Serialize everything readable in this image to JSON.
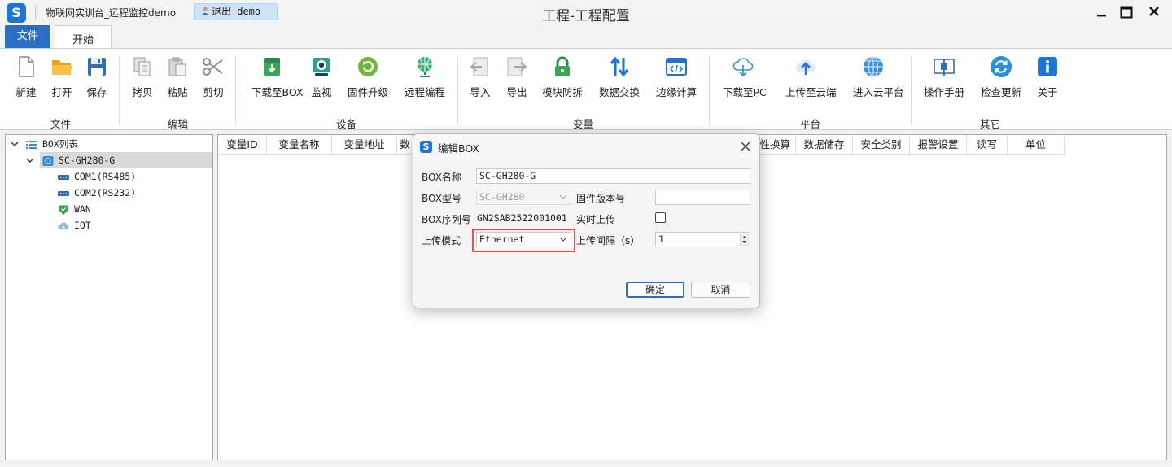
{
  "titlebar": {
    "project_name": "物联网实训台_远程监控demo",
    "logout_label": "退出 demo",
    "window_title": "工程-工程配置"
  },
  "tabs": {
    "file": "文件",
    "start": "开始"
  },
  "ribbon": {
    "groups": {
      "file": "文件",
      "edit": "编辑",
      "device": "设备",
      "variable": "变量",
      "platform": "平台",
      "other": "其它"
    },
    "buttons": {
      "new": "新建",
      "open": "打开",
      "save": "保存",
      "copy": "拷贝",
      "paste": "粘贴",
      "cut": "剪切",
      "download_box": "下载至BOX",
      "monitor": "监视",
      "firmware": "固件升级",
      "remote_prog": "远程编程",
      "import": "导入",
      "export": "导出",
      "module_protect": "模块防拆",
      "data_exchange": "数据交换",
      "edge_compute": "边缘计算",
      "download_pc": "下载至PC",
      "upload_cloud": "上传至云端",
      "enter_cloud": "进入云平台",
      "manual": "操作手册",
      "check_update": "检查更新",
      "about": "关于"
    }
  },
  "tree": {
    "root": "BOX列表",
    "box": "SC-GH280-G",
    "children": [
      "COM1(RS485)",
      "COM2(RS232)",
      "WAN",
      "IOT"
    ]
  },
  "table": {
    "columns": [
      "变量ID",
      "变量名称",
      "变量地址",
      "数",
      "性换算",
      "数据储存",
      "安全类别",
      "报警设置",
      "读写",
      "单位"
    ]
  },
  "dialog": {
    "title": "编辑BOX",
    "box_name_label": "BOX名称",
    "box_name_value": "SC-GH280-G",
    "box_model_label": "BOX型号",
    "box_model_value": "SC-GH280",
    "firmware_label": "固件版本号",
    "firmware_value": "",
    "serial_label": "BOX序列号",
    "serial_value": "GN2SAB2522001001",
    "realtime_label": "实时上传",
    "upload_mode_label": "上传模式",
    "upload_mode_value": "Ethernet",
    "interval_label": "上传间隔（s）",
    "interval_value": "1",
    "ok": "确定",
    "cancel": "取消"
  },
  "colors": {
    "accent": "#2b6fc4",
    "highlight": "#e25555",
    "logo": "#1e74d6"
  }
}
